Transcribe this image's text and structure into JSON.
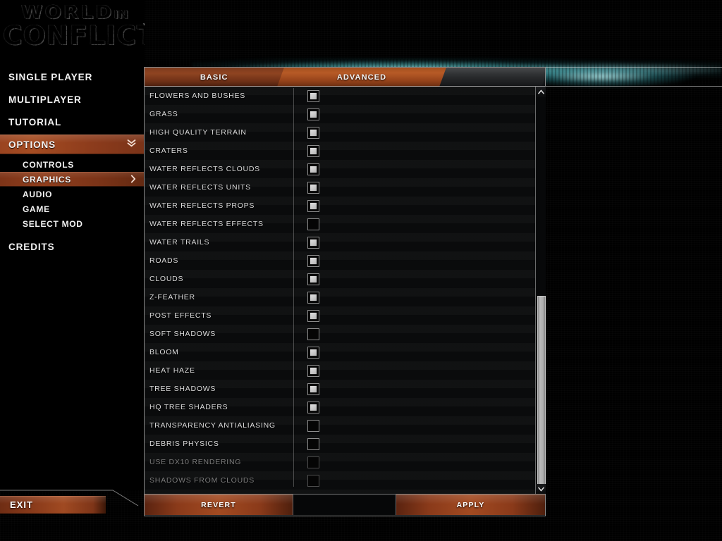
{
  "logo": {
    "line1_main": "WORLD",
    "line1_small": "IN",
    "line2": "CONFLICT",
    "trademark": "™"
  },
  "sidebar": {
    "items": [
      {
        "label": "SINGLE PLAYER",
        "level": "top",
        "state": "normal",
        "icon": ""
      },
      {
        "label": "MULTIPLAYER",
        "level": "top",
        "state": "normal",
        "icon": ""
      },
      {
        "label": "TUTORIAL",
        "level": "top",
        "state": "normal",
        "icon": ""
      },
      {
        "label": "OPTIONS",
        "level": "top",
        "state": "active",
        "icon": "chevron-double-down-icon"
      },
      {
        "label": "CONTROLS",
        "level": "sub",
        "state": "normal",
        "icon": ""
      },
      {
        "label": "GRAPHICS",
        "level": "sub",
        "state": "active",
        "icon": "chevron-right-icon"
      },
      {
        "label": "AUDIO",
        "level": "sub",
        "state": "normal",
        "icon": ""
      },
      {
        "label": "GAME",
        "level": "sub",
        "state": "normal",
        "icon": ""
      },
      {
        "label": "SELECT MOD",
        "level": "sub",
        "state": "normal",
        "icon": ""
      },
      {
        "label": "CREDITS",
        "level": "top",
        "state": "normal",
        "icon": ""
      }
    ],
    "exit_label": "EXIT"
  },
  "tabs": [
    {
      "label": "BASIC",
      "active": false
    },
    {
      "label": "ADVANCED",
      "active": true
    }
  ],
  "settings": {
    "rows": [
      {
        "label": "FLOWERS AND BUSHES",
        "checked": true,
        "enabled": true
      },
      {
        "label": "GRASS",
        "checked": true,
        "enabled": true
      },
      {
        "label": "HIGH QUALITY TERRAIN",
        "checked": true,
        "enabled": true
      },
      {
        "label": "CRATERS",
        "checked": true,
        "enabled": true
      },
      {
        "label": "WATER REFLECTS CLOUDS",
        "checked": true,
        "enabled": true
      },
      {
        "label": "WATER REFLECTS UNITS",
        "checked": true,
        "enabled": true
      },
      {
        "label": "WATER REFLECTS PROPS",
        "checked": true,
        "enabled": true
      },
      {
        "label": "WATER REFLECTS EFFECTS",
        "checked": false,
        "enabled": true
      },
      {
        "label": "WATER TRAILS",
        "checked": true,
        "enabled": true
      },
      {
        "label": "ROADS",
        "checked": true,
        "enabled": true
      },
      {
        "label": "CLOUDS",
        "checked": true,
        "enabled": true
      },
      {
        "label": "Z-FEATHER",
        "checked": true,
        "enabled": true
      },
      {
        "label": "POST EFFECTS",
        "checked": true,
        "enabled": true
      },
      {
        "label": "SOFT SHADOWS",
        "checked": false,
        "enabled": true
      },
      {
        "label": "BLOOM",
        "checked": true,
        "enabled": true
      },
      {
        "label": "HEAT HAZE",
        "checked": true,
        "enabled": true
      },
      {
        "label": "TREE SHADOWS",
        "checked": true,
        "enabled": true
      },
      {
        "label": "HQ TREE SHADERS",
        "checked": true,
        "enabled": true
      },
      {
        "label": "TRANSPARENCY ANTIALIASING",
        "checked": false,
        "enabled": true
      },
      {
        "label": "DEBRIS PHYSICS",
        "checked": false,
        "enabled": true
      },
      {
        "label": "USE DX10 RENDERING",
        "checked": false,
        "enabled": false
      },
      {
        "label": "SHADOWS FROM CLOUDS",
        "checked": false,
        "enabled": false
      }
    ]
  },
  "scrollbar": {
    "up_icon": "chevron-up-icon",
    "down_icon": "chevron-down-icon",
    "thumb_position_percent": 50
  },
  "actions": {
    "revert_label": "REVERT",
    "apply_label": "APPLY"
  },
  "colors": {
    "accent_orange": "#a24a21",
    "accent_orange_dark": "#7a3318",
    "glow_cyan": "#5ad2d7",
    "panel_bg": "#0a0b0c",
    "text": "#e8e8e8"
  }
}
